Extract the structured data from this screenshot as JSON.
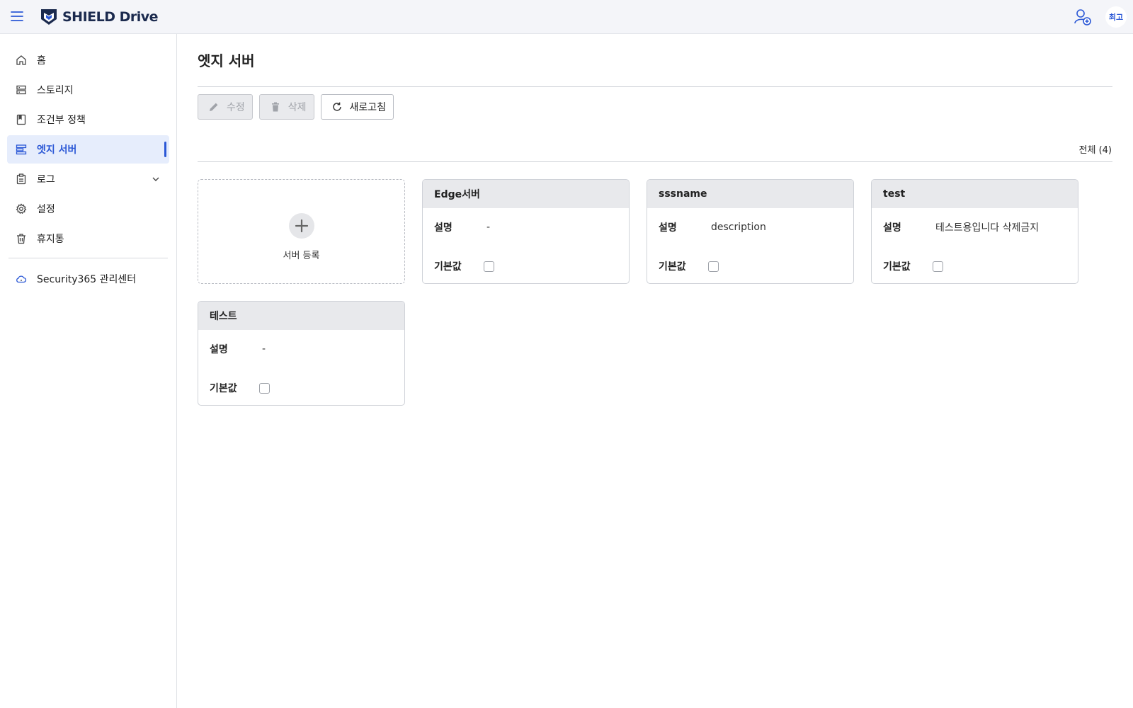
{
  "header": {
    "brand_prefix": "SHIELD",
    "brand_suffix": " Drive",
    "avatar_text": "최고"
  },
  "sidebar": {
    "items": [
      {
        "label": "홈",
        "icon": "home-icon"
      },
      {
        "label": "스토리지",
        "icon": "storage-icon"
      },
      {
        "label": "조건부 정책",
        "icon": "policy-icon"
      },
      {
        "label": "엣지 서버",
        "icon": "server-icon",
        "active": true
      },
      {
        "label": "로그",
        "icon": "log-icon"
      },
      {
        "label": "설정",
        "icon": "gear-icon"
      },
      {
        "label": "휴지통",
        "icon": "trash-icon"
      }
    ],
    "external_link": {
      "label": "Security365 관리센터",
      "icon": "cloud-icon"
    }
  },
  "main": {
    "title": "엣지 서버",
    "toolbar": {
      "edit_label": "수정",
      "delete_label": "삭제",
      "refresh_label": "새로고침"
    },
    "total_label": "전체 (4)",
    "add_card_label": "서버 등록",
    "field_labels": {
      "description": "설명",
      "default": "기본값"
    },
    "servers": [
      {
        "name": "Edge서버",
        "description": "-",
        "default": false
      },
      {
        "name": "sssname",
        "description": "description",
        "default": false
      },
      {
        "name": "test",
        "description": "테스트용입니다 삭제금지",
        "default": false
      },
      {
        "name": "테스트",
        "description": "-",
        "default": false
      }
    ]
  },
  "colors": {
    "accent": "#2b58d6",
    "header_bg": "#f4f5f9",
    "active_nav_bg": "#e6edfc",
    "card_head_bg": "#e8e9ec"
  }
}
